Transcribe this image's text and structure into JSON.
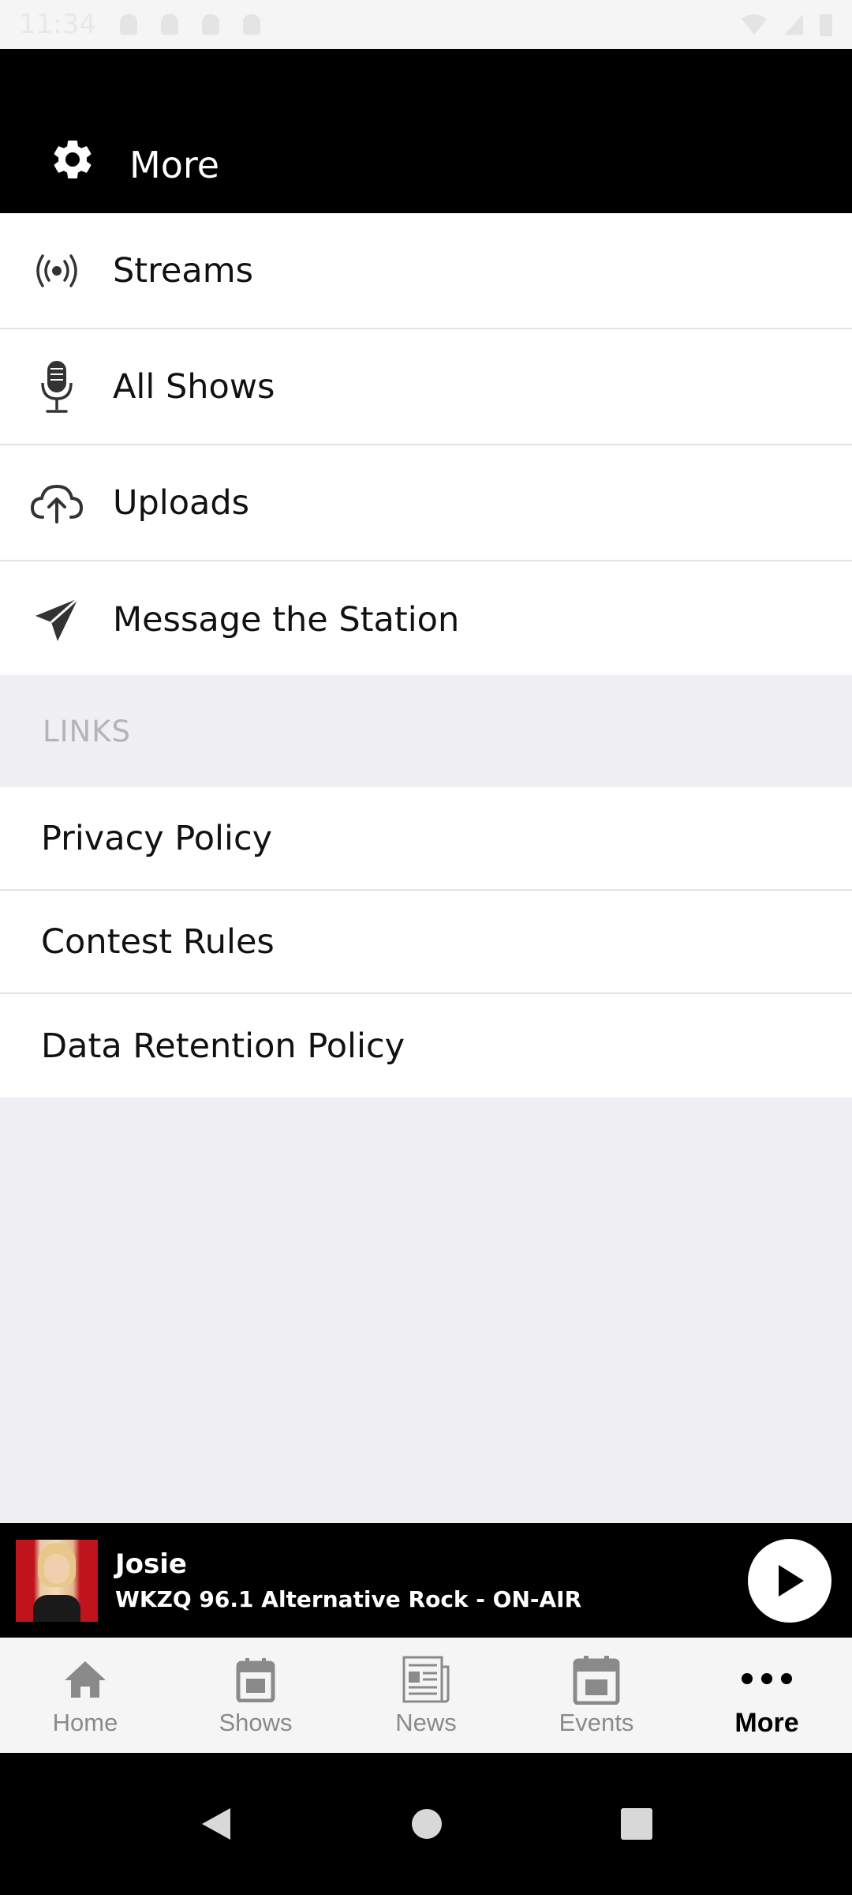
{
  "status_bar": {
    "time": "11:34"
  },
  "header": {
    "title": "More",
    "icon": "gear-icon"
  },
  "menu": {
    "items": [
      {
        "label": "Streams",
        "icon": "broadcast-icon"
      },
      {
        "label": "All Shows",
        "icon": "microphone-icon"
      },
      {
        "label": "Uploads",
        "icon": "cloud-upload-icon"
      },
      {
        "label": "Message the Station",
        "icon": "paper-plane-icon"
      }
    ]
  },
  "links": {
    "header": "LINKS",
    "items": [
      {
        "label": "Privacy Policy"
      },
      {
        "label": "Contest Rules"
      },
      {
        "label": "Data Retention Policy"
      }
    ]
  },
  "player": {
    "title": "Josie",
    "subtitle": "WKZQ 96.1 Alternative Rock - ON-AIR",
    "play_icon": "play-icon"
  },
  "tabbar": {
    "tabs": [
      {
        "label": "Home",
        "icon": "home-icon",
        "active": false
      },
      {
        "label": "Shows",
        "icon": "calendar-icon",
        "active": false
      },
      {
        "label": "News",
        "icon": "newspaper-icon",
        "active": false
      },
      {
        "label": "Events",
        "icon": "calendar-icon",
        "active": false
      },
      {
        "label": "More",
        "icon": "more-dots-icon",
        "active": true
      }
    ]
  },
  "colors": {
    "header_bg": "#000000",
    "list_bg": "#ffffff",
    "page_bg": "#efeff4",
    "tab_active": "#000000",
    "tab_inactive": "#8a8a8a"
  }
}
